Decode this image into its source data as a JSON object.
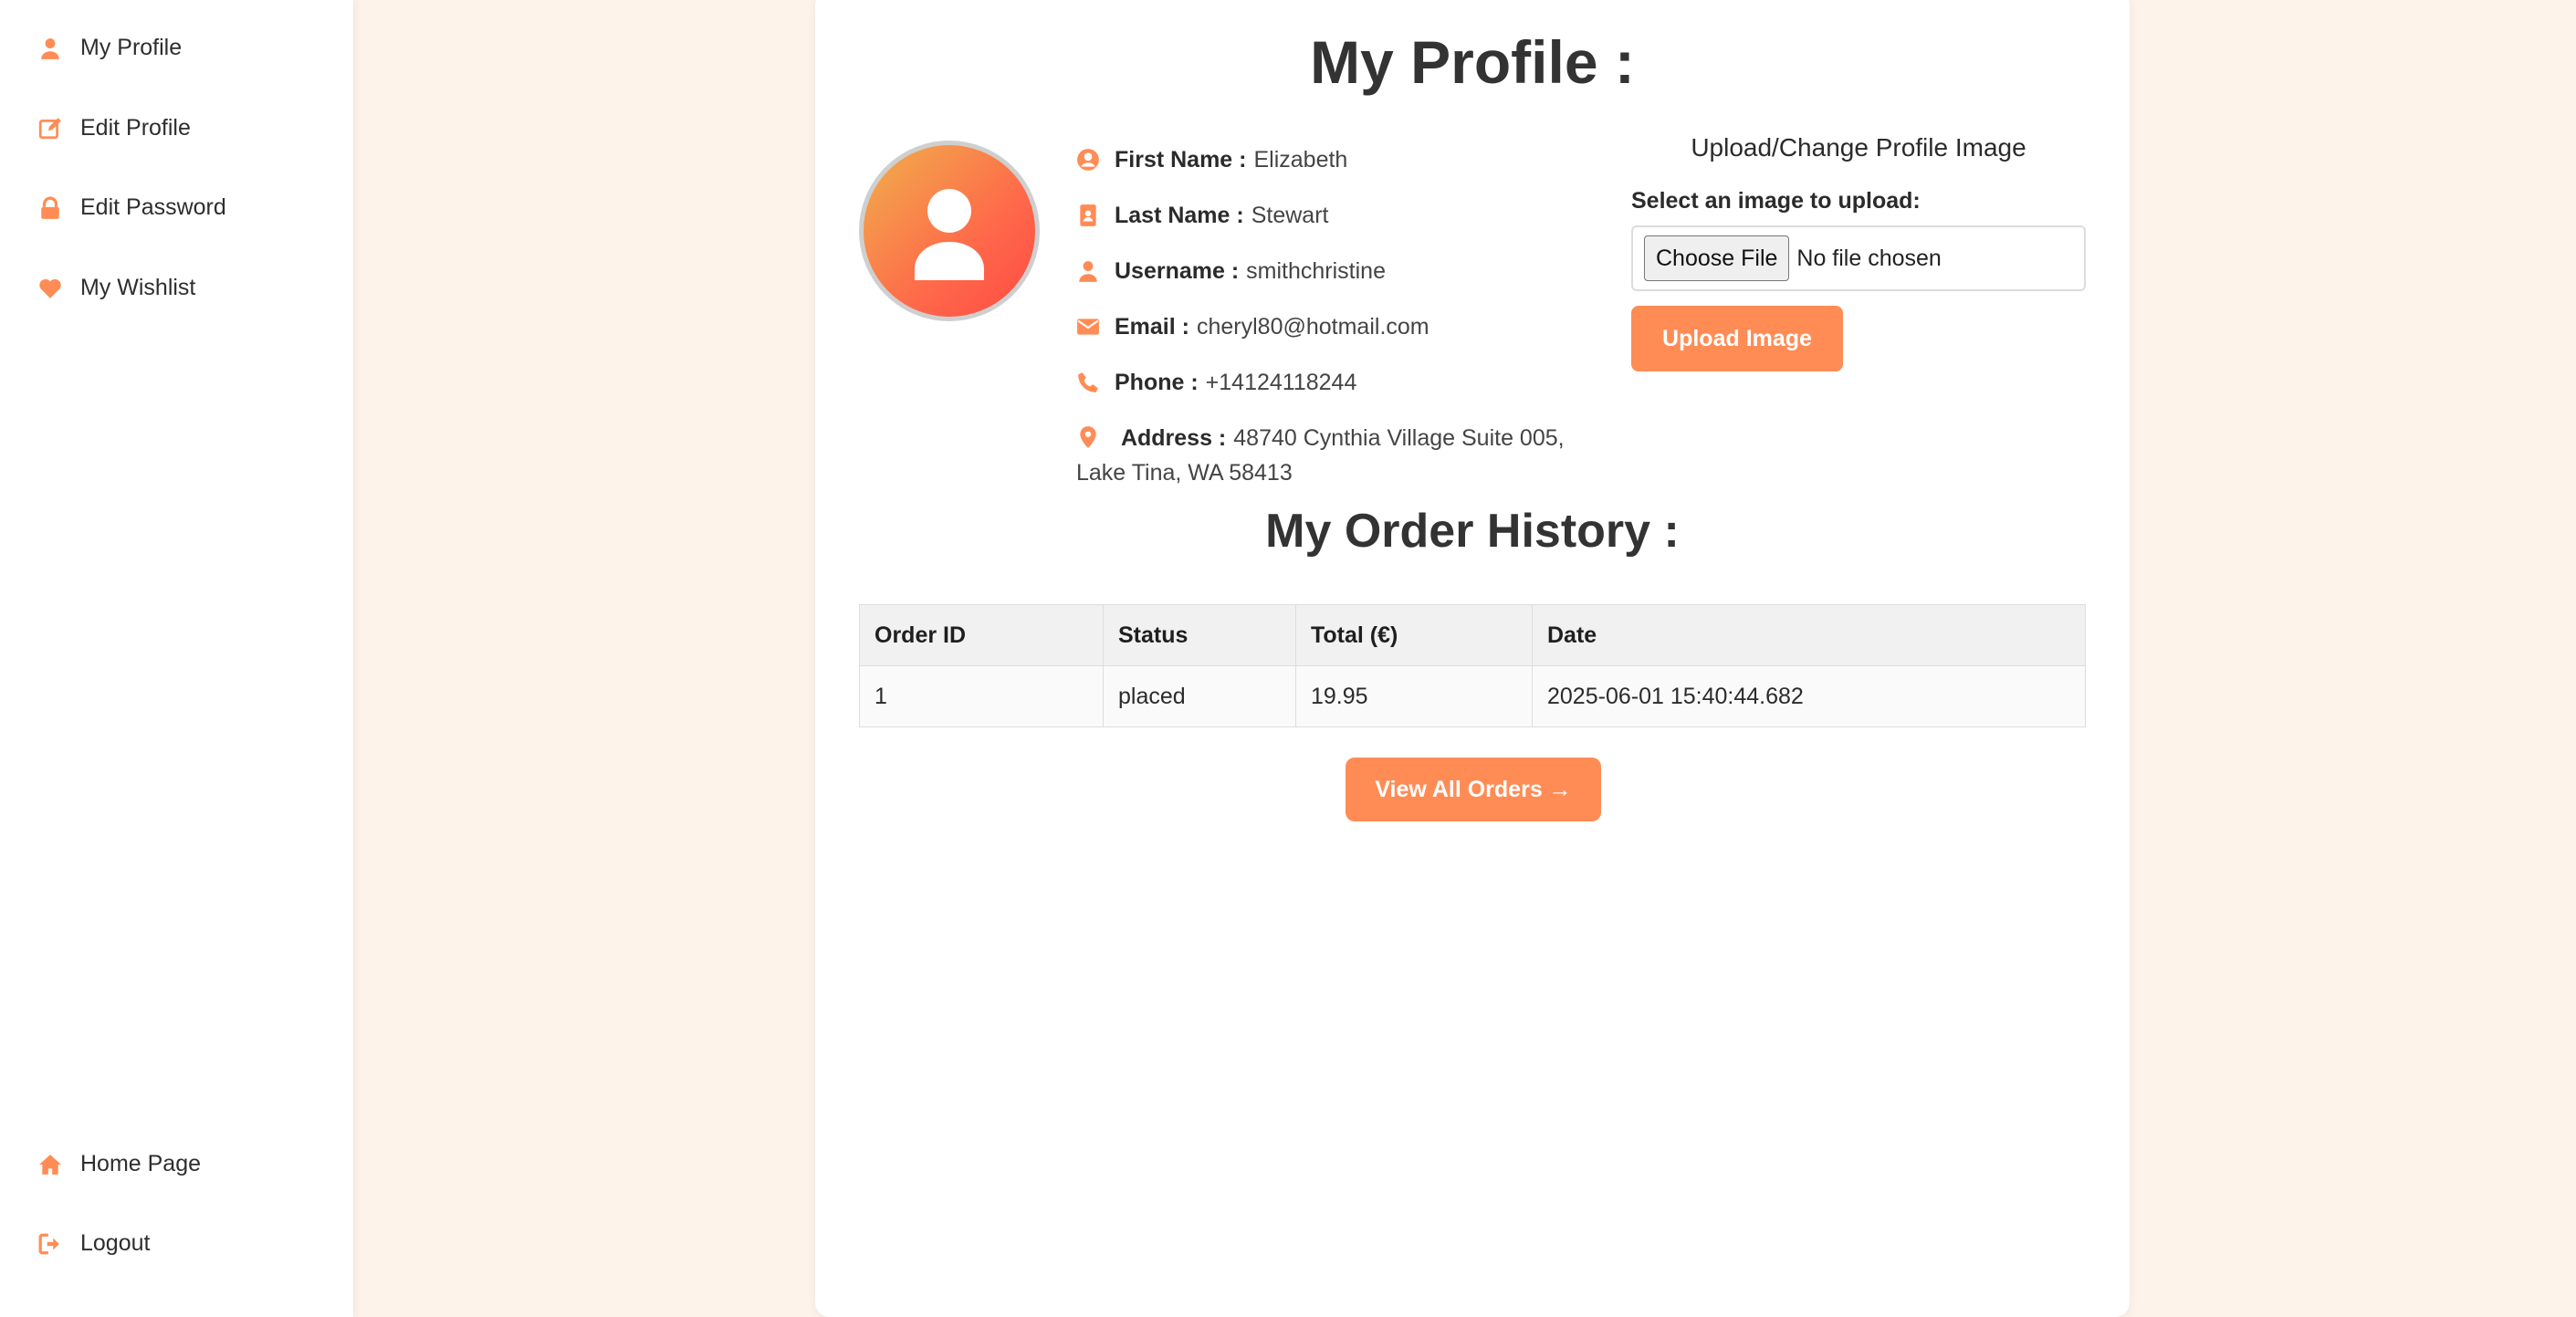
{
  "sidebar": {
    "items": [
      {
        "label": "My Profile",
        "icon": "user-icon"
      },
      {
        "label": "Edit Profile",
        "icon": "edit-icon"
      },
      {
        "label": "Edit Password",
        "icon": "lock-icon"
      },
      {
        "label": "My Wishlist",
        "icon": "heart-icon"
      }
    ],
    "bottom": [
      {
        "label": "Home Page",
        "icon": "home-icon"
      },
      {
        "label": "Logout",
        "icon": "logout-icon"
      }
    ]
  },
  "profile": {
    "title": "My Profile :",
    "fields": {
      "first_name": {
        "label": "First Name :",
        "value": "Elizabeth"
      },
      "last_name": {
        "label": "Last Name :",
        "value": "Stewart"
      },
      "username": {
        "label": "Username :",
        "value": "smithchristine"
      },
      "email": {
        "label": "Email :",
        "value": "cheryl80@hotmail.com"
      },
      "phone": {
        "label": "Phone :",
        "value": "+14124118244"
      },
      "address": {
        "label": "Address :",
        "value": "48740 Cynthia Village Suite 005, Lake Tina, WA 58413"
      }
    }
  },
  "upload": {
    "title": "Upload/Change Profile Image",
    "label": "Select an image to upload:",
    "choose_label": "Choose File",
    "no_file": "No file chosen",
    "button": "Upload Image"
  },
  "orders": {
    "title": "My Order History :",
    "columns": [
      "Order ID",
      "Status",
      "Total (€)",
      "Date"
    ],
    "rows": [
      [
        "1",
        "placed",
        "19.95",
        "2025-06-01 15:40:44.682"
      ]
    ],
    "view_all": "View All Orders →"
  },
  "colors": {
    "accent": "#ff8c55",
    "background": "#fdf3eb"
  }
}
